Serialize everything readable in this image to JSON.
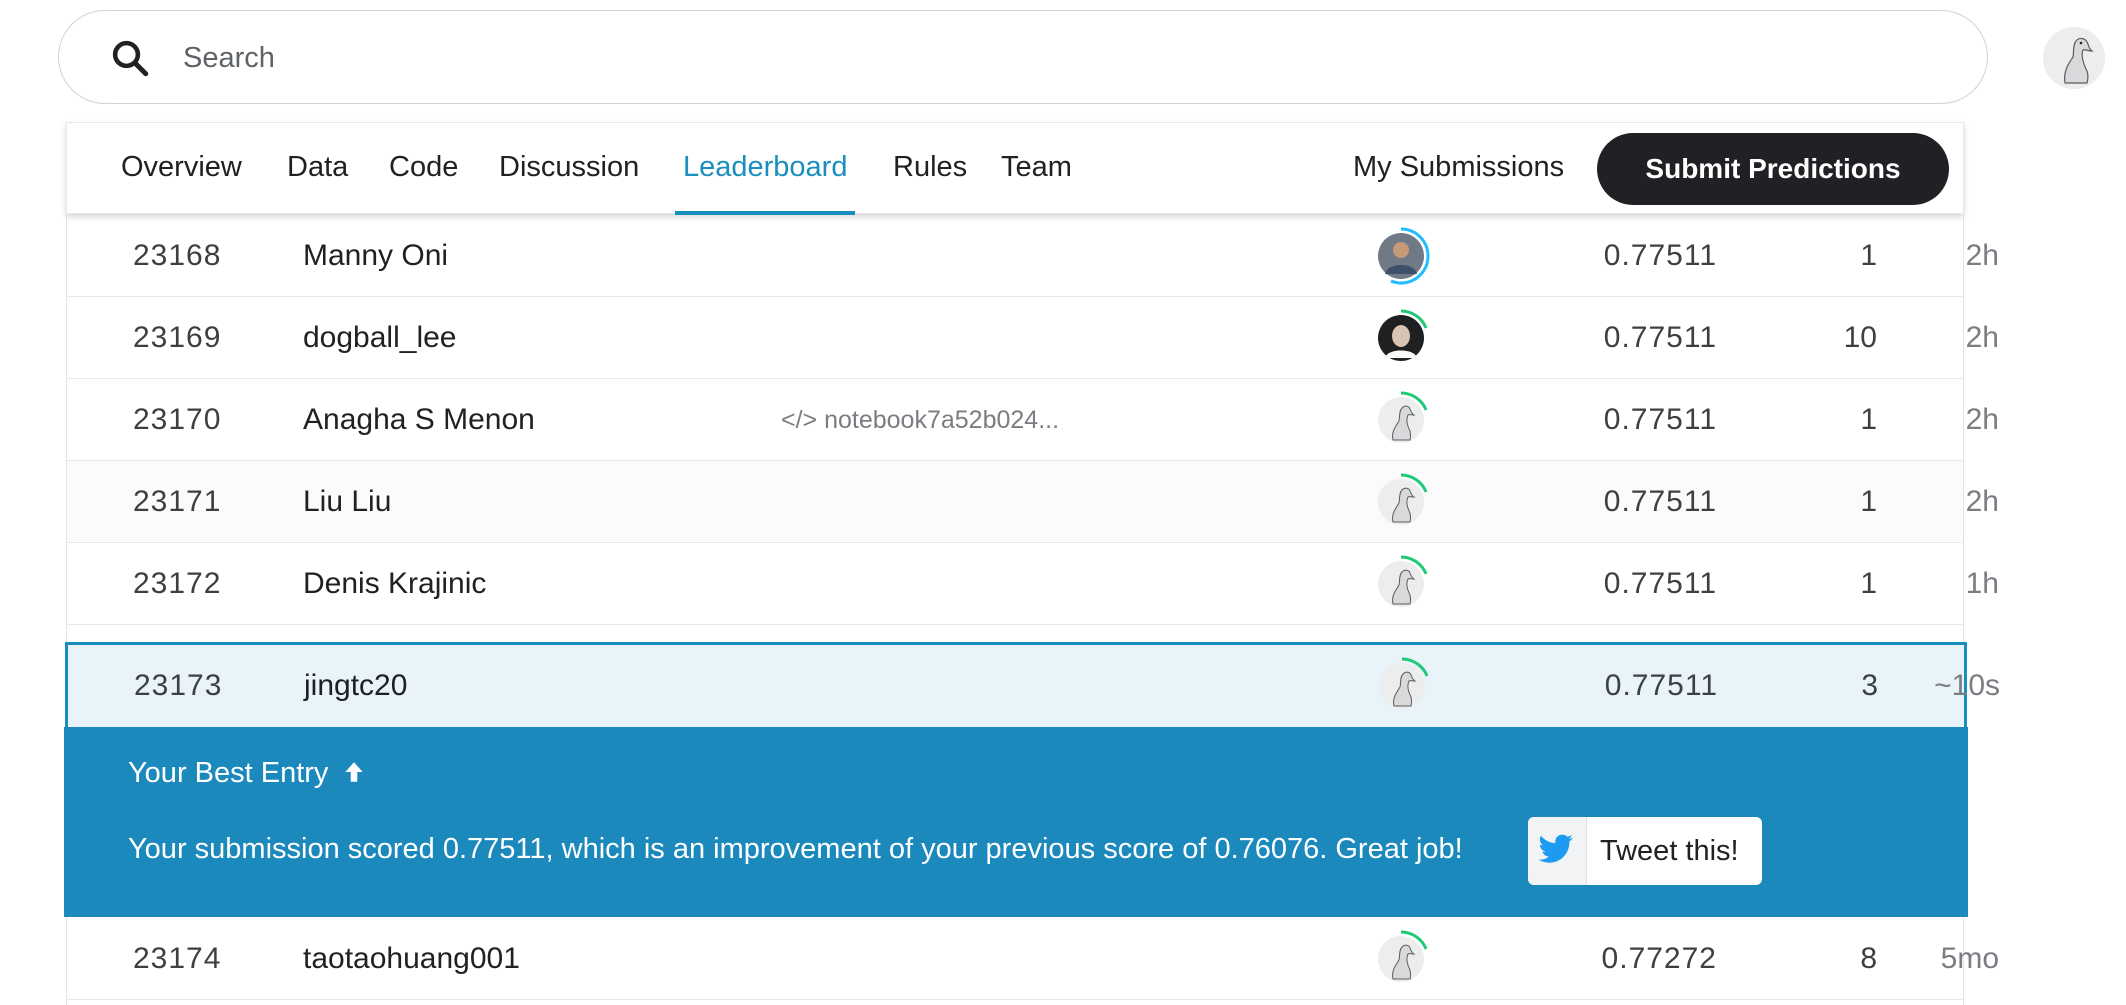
{
  "search": {
    "placeholder": "Search"
  },
  "tabs": [
    {
      "label": "Overview"
    },
    {
      "label": "Data"
    },
    {
      "label": "Code"
    },
    {
      "label": "Discussion"
    },
    {
      "label": "Leaderboard",
      "active": true
    },
    {
      "label": "Rules"
    },
    {
      "label": "Team"
    }
  ],
  "actions": {
    "my_submissions": "My Submissions",
    "submit": "Submit Predictions"
  },
  "accent_color": "#1a8fbf",
  "leaderboard": {
    "rows": [
      {
        "rank": "23168",
        "team": "Manny Oni",
        "notebook": "",
        "score": "0.77511",
        "entries": "1",
        "last": "2h",
        "avatar": "photo-avatar",
        "tier_color": "#20beff"
      },
      {
        "rank": "23169",
        "team": "dogball_lee",
        "notebook": "",
        "score": "0.77511",
        "entries": "10",
        "last": "2h",
        "avatar": "photo-avatar",
        "tier_color": "#20c978"
      },
      {
        "rank": "23170",
        "team": "Anagha S Menon",
        "notebook": "</> notebook7a52b024...",
        "score": "0.77511",
        "entries": "1",
        "last": "2h",
        "avatar": "goose-avatar",
        "tier_color": "#20c978"
      },
      {
        "rank": "23171",
        "team": "Liu Liu",
        "notebook": "",
        "score": "0.77511",
        "entries": "1",
        "last": "2h",
        "avatar": "goose-avatar",
        "tier_color": "#20c978"
      },
      {
        "rank": "23172",
        "team": "Denis Krajinic",
        "notebook": "",
        "score": "0.77511",
        "entries": "1",
        "last": "1h",
        "avatar": "goose-avatar",
        "tier_color": "#20c978"
      },
      {
        "rank": "23173",
        "team": "jingtc20",
        "notebook": "",
        "score": "0.77511",
        "entries": "3",
        "last": "~10s",
        "avatar": "goose-avatar",
        "tier_color": "#20c978",
        "is_me": true
      },
      {
        "rank": "23174",
        "team": "taotaohuang001",
        "notebook": "",
        "score": "0.77272",
        "entries": "8",
        "last": "5mo",
        "avatar": "goose-avatar",
        "tier_color": "#20c978"
      }
    ]
  },
  "banner": {
    "title": "Your Best Entry",
    "message": "Your submission scored 0.77511, which is an improvement of your previous score of 0.76076. Great job!",
    "tweet_label": "Tweet this!",
    "background": "#1b89bc"
  }
}
